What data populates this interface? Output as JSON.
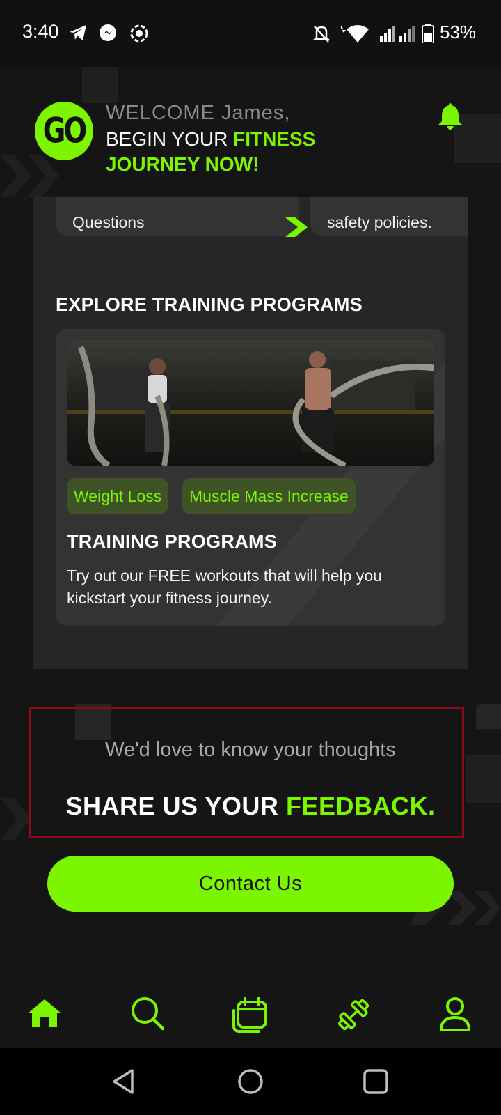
{
  "status_bar": {
    "time": "3:40",
    "battery": "53%",
    "icons": [
      "telegram-icon",
      "messenger-icon",
      "screen-record-icon",
      "mute-icon",
      "wifi-icon",
      "signal-icon",
      "battery-icon"
    ]
  },
  "header": {
    "welcome": "WELCOME James,",
    "tagline_prefix": "BEGIN YOUR ",
    "tagline_highlight": "FITNESS JOURNEY NOW!",
    "logo_text": "GO"
  },
  "quick_cards": [
    {
      "label": "Questions"
    },
    {
      "label": "safety policies."
    }
  ],
  "programs": {
    "section_title": "EXPLORE TRAINING PROGRAMS",
    "card": {
      "tags": [
        "Weight Loss",
        "Muscle Mass Increase"
      ],
      "title": "TRAINING PROGRAMS",
      "description": "Try out our FREE workouts that will help you kickstart your fitness journey."
    }
  },
  "feedback": {
    "subtitle": "We'd love to know your thoughts",
    "heading_prefix": "SHARE US YOUR ",
    "heading_highlight": "FEEDBACK."
  },
  "contact_button": "Contact Us",
  "bottom_nav": [
    "home-icon",
    "search-icon",
    "calendar-icon",
    "dumbbell-icon",
    "profile-icon"
  ],
  "colors": {
    "accent": "#7cf500",
    "background": "#151515",
    "card": "#333333",
    "panel": "#262626",
    "highlight_border": "#8a0b1c"
  }
}
